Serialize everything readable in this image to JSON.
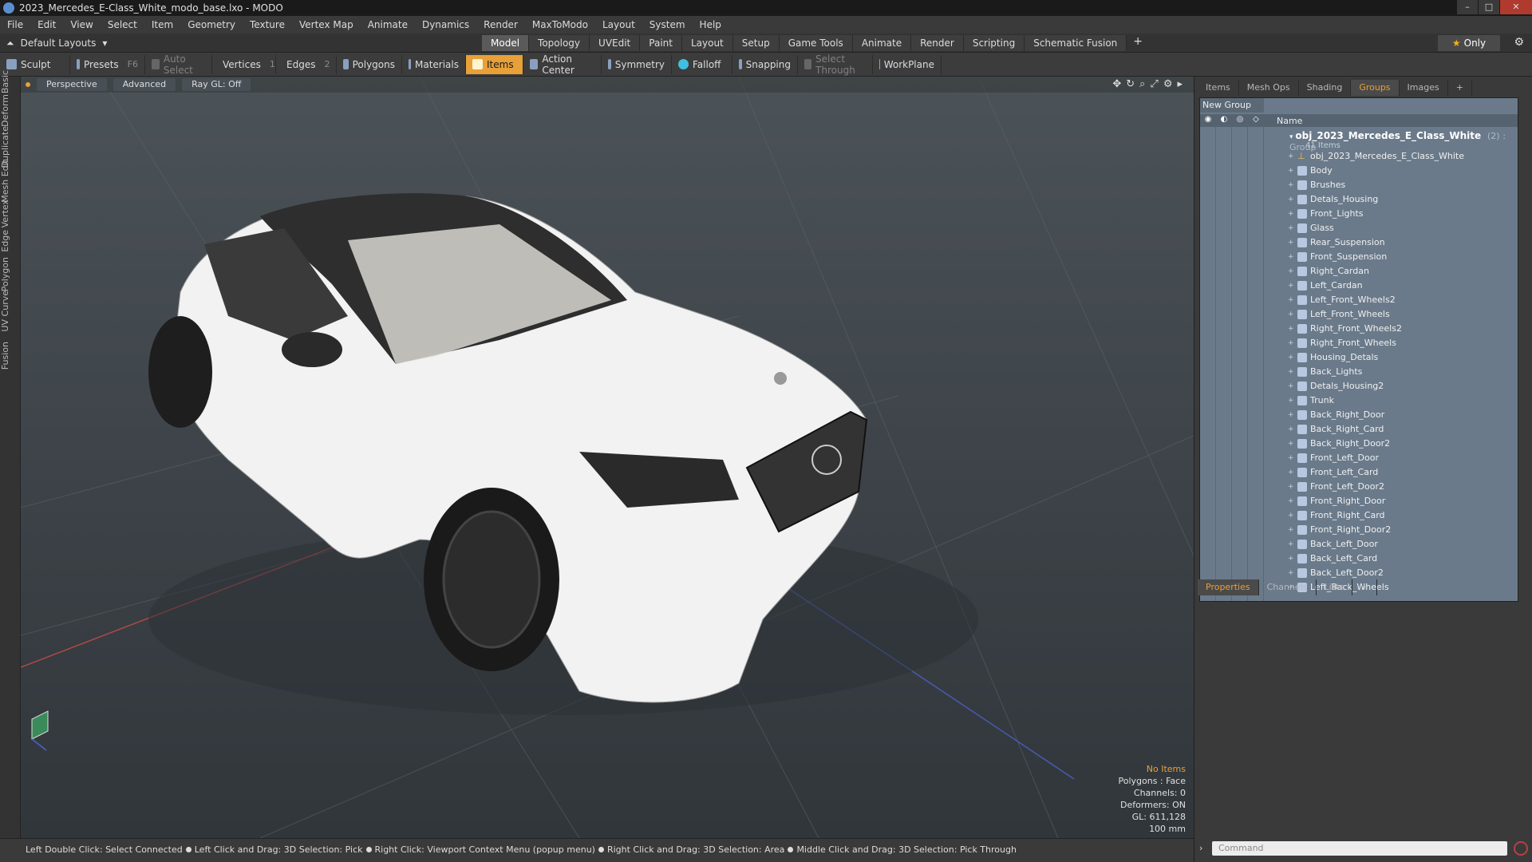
{
  "window": {
    "title": "2023_Mercedes_E-Class_White_modo_base.lxo - MODO"
  },
  "menu": [
    "File",
    "Edit",
    "View",
    "Select",
    "Item",
    "Geometry",
    "Texture",
    "Vertex Map",
    "Animate",
    "Dynamics",
    "Render",
    "MaxToModo",
    "Layout",
    "System",
    "Help"
  ],
  "layout_selector": "Default Layouts",
  "layout_tabs": [
    {
      "label": "Model",
      "active": true
    },
    {
      "label": "Topology"
    },
    {
      "label": "UVEdit"
    },
    {
      "label": "Paint"
    },
    {
      "label": "Layout"
    },
    {
      "label": "Setup"
    },
    {
      "label": "Game Tools"
    },
    {
      "label": "Animate"
    },
    {
      "label": "Render"
    },
    {
      "label": "Scripting"
    },
    {
      "label": "Schematic Fusion"
    }
  ],
  "only_label": "Only",
  "toolbar": {
    "sculpt": "Sculpt",
    "presets": "Presets",
    "presets_key": "F6",
    "auto_select": "Auto Select",
    "vertices": "Vertices",
    "vertices_count": "1",
    "edges": "Edges",
    "edges_count": "2",
    "polygons": "Polygons",
    "materials": "Materials",
    "items": "Items",
    "action_center": "Action Center",
    "symmetry": "Symmetry",
    "falloff": "Falloff",
    "snapping": "Snapping",
    "select_through": "Select Through",
    "workplane": "WorkPlane"
  },
  "left_tabs": [
    "Basic",
    "Deform",
    "Duplicate",
    "Mesh Edit",
    "Vertex",
    "Edge",
    "Polygon",
    "Curve",
    "UV",
    "Fusion"
  ],
  "viewport": {
    "view": "Perspective",
    "shading": "Advanced",
    "raygl": "Ray GL: Off",
    "info": {
      "no_items": "No Items",
      "polygons": "Polygons : Face",
      "channels": "Channels: 0",
      "deformers": "Deformers: ON",
      "gl": "GL: 611,128",
      "scale": "100 mm"
    }
  },
  "status": [
    "Left Double Click: Select Connected",
    "Left Click and Drag: 3D Selection: Pick",
    "Right Click: Viewport Context Menu (popup menu)",
    "Right Click and Drag: 3D Selection: Area",
    "Middle Click and Drag: 3D Selection: Pick Through"
  ],
  "panel_tabs": [
    {
      "label": "Items"
    },
    {
      "label": "Mesh Ops"
    },
    {
      "label": "Shading"
    },
    {
      "label": "Groups",
      "active": true
    },
    {
      "label": "Images"
    }
  ],
  "groups": {
    "new_group": "New Group",
    "name_header": "Name",
    "group_name": "obj_2023_Mercedes_E_Class_White",
    "group_count": "(2)",
    "group_type": ": Group",
    "items_count": "41 Items",
    "items": [
      "obj_2023_Mercedes_E_Class_White",
      "Body",
      "Brushes",
      "Detals_Housing",
      "Front_Lights",
      "Glass",
      "Rear_Suspension",
      "Front_Suspension",
      "Right_Cardan",
      "Left_Cardan",
      "Left_Front_Wheels2",
      "Left_Front_Wheels",
      "Right_Front_Wheels2",
      "Right_Front_Wheels",
      "Housing_Detals",
      "Back_Lights",
      "Detals_Housing2",
      "Trunk",
      "Back_Right_Door",
      "Back_Right_Card",
      "Back_Right_Door2",
      "Front_Left_Door",
      "Front_Left_Card",
      "Front_Left_Door2",
      "Front_Right_Door",
      "Front_Right_Card",
      "Front_Right_Door2",
      "Back_Left_Door",
      "Back_Left_Card",
      "Back_Left_Door2",
      "Left_Back_Wheels"
    ]
  },
  "props_tabs": [
    {
      "label": "Properties",
      "active": true
    },
    {
      "label": "Channels"
    },
    {
      "label": "Lists"
    }
  ],
  "command_placeholder": "Command"
}
